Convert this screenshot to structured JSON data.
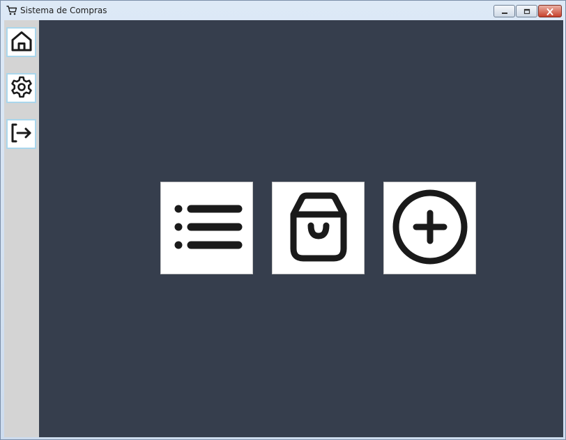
{
  "window": {
    "title": "Sistema de Compras",
    "title_icon": "shopping-cart-icon"
  },
  "window_controls": {
    "minimize_icon": "minimize-icon",
    "maximize_icon": "maximize-icon",
    "close_icon": "close-icon"
  },
  "sidebar": {
    "items": [
      {
        "icon": "home-icon"
      },
      {
        "icon": "gear-icon"
      },
      {
        "icon": "logout-icon"
      }
    ]
  },
  "main": {
    "tiles": [
      {
        "icon": "list-icon"
      },
      {
        "icon": "shopping-bag-icon"
      },
      {
        "icon": "plus-circle-icon"
      }
    ]
  },
  "colors": {
    "content_background": "#363e4d",
    "sidebar_background": "#d4d4d4",
    "sidebar_button_border": "#a9d6ec",
    "tile_background": "#ffffff",
    "icon_stroke": "#1a1a1a",
    "close_button": "#c7412c"
  }
}
